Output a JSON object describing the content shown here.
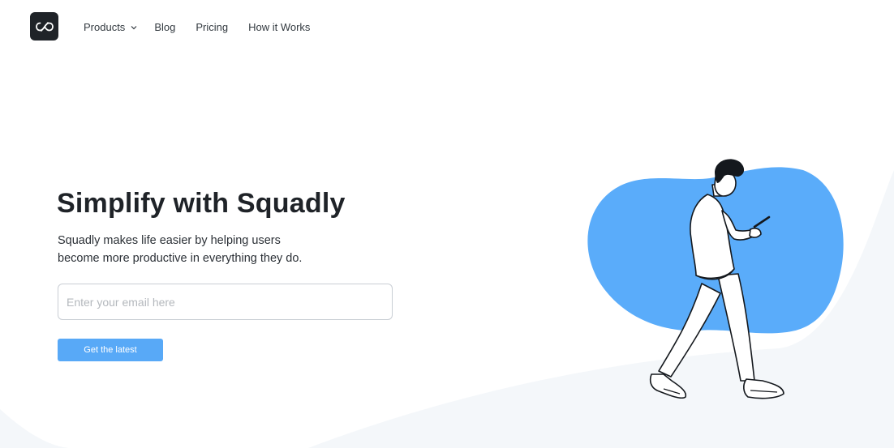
{
  "header": {
    "logo_icon": "infinity-link-icon",
    "nav": {
      "products": "Products",
      "blog": "Blog",
      "pricing": "Pricing",
      "how_it_works": "How it Works"
    }
  },
  "hero": {
    "title": "Simplify with Squadly",
    "subtitle_line1": "Squadly makes life easier by helping users",
    "subtitle_line2": "become more productive in everything they do.",
    "email_placeholder": "Enter your email here",
    "email_value": "",
    "cta_label": "Get the latest"
  },
  "illustration": {
    "description_icon": "walking-person-phone-icon"
  },
  "colors": {
    "accent": "#58a9f7",
    "blob": "#5aacfa",
    "dark": "#1f2328",
    "background_wave": "#f4f7fa"
  }
}
